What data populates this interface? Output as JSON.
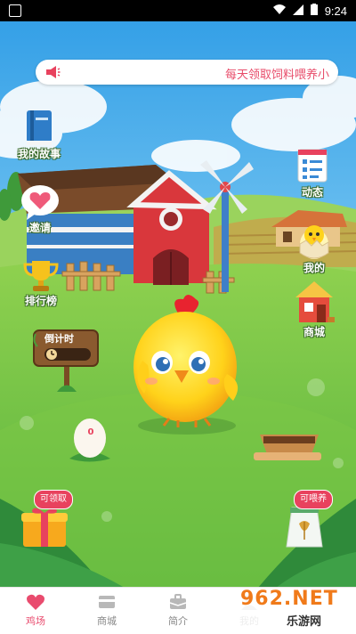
{
  "status_bar": {
    "time": "9:24"
  },
  "banner": {
    "message": "每天领取饲料喂养小"
  },
  "side_buttons": {
    "story": "我的故事",
    "invite": "邀请",
    "ranking": "排行榜",
    "feed": "动态",
    "mine": "我的",
    "shop": "商城"
  },
  "timer": {
    "label": "倒计时"
  },
  "egg": {
    "count": "0"
  },
  "badges": {
    "claim": "可领取",
    "feedable": "可喂养"
  },
  "nav": {
    "items": [
      {
        "label": "鸡场",
        "icon": "heart-icon",
        "active": true
      },
      {
        "label": "商城",
        "icon": "card-icon",
        "active": false
      },
      {
        "label": "简介",
        "icon": "briefcase-icon",
        "active": false
      },
      {
        "label": "我的",
        "icon": "user-icon",
        "active": false
      }
    ]
  },
  "watermark": {
    "brand": "962.NET",
    "site": "乐游网"
  },
  "colors": {
    "accent": "#e94b6e",
    "sky": "#4fb3e8",
    "grass": "#6cc24a"
  }
}
